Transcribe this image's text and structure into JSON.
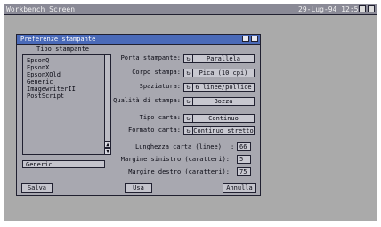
{
  "screen": {
    "title": "Workbench Screen",
    "clock": "29-Lug-94 12:51"
  },
  "window": {
    "title": "Preferenze stampante"
  },
  "printer_list": {
    "header": "Tipo stampante",
    "items": [
      "EpsonQ",
      "EpsonX",
      "EpsonXOld",
      "Generic",
      "ImagewriterII",
      "PostScript"
    ],
    "selected": "Generic"
  },
  "settings": [
    {
      "label": "Porta stampante:",
      "value": "Parallela"
    },
    {
      "label": "Corpo stampa:",
      "value": "Pica (10 cpi)"
    },
    {
      "label": "Spaziatura:",
      "value": "6 linee/pollice"
    },
    {
      "label": "Qualità di stampa:",
      "value": "Bozza"
    },
    {
      "label": "Tipo carta:",
      "value": "Continuo"
    },
    {
      "label": "Formato carta:",
      "value": "Continuo stretto"
    }
  ],
  "numeric": [
    {
      "label": "Lunghezza carta (linee)",
      "sep": ":",
      "value": "66"
    },
    {
      "label": "Margine sinistro (caratteri):",
      "value": "5"
    },
    {
      "label": "Margine destro (caratteri):",
      "value": "75"
    }
  ],
  "buttons": {
    "save": "Salva",
    "use": "Usa",
    "cancel": "Annulla"
  },
  "icons": {
    "cycle": "cycle-gadget-icon",
    "scroll_up": "arrow-up-icon",
    "scroll_down": "arrow-down-icon",
    "depth": "depth-gadget-icon"
  },
  "colors": {
    "screen_bg": "#aaaaaa",
    "window_title_bar": "#4a6ab8",
    "text": "#0a0a14"
  }
}
